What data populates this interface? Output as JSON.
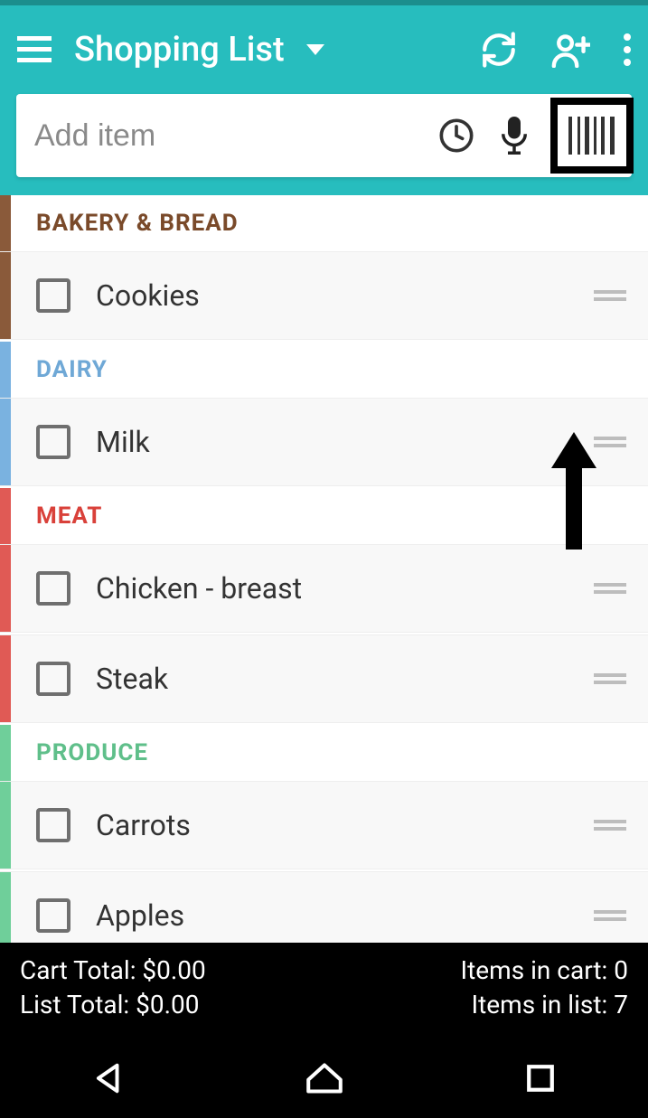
{
  "header": {
    "title": "Shopping List"
  },
  "search": {
    "placeholder": "Add item"
  },
  "categories": [
    {
      "name": "BAKERY & BREAD",
      "color": "#7a4a2a",
      "stripe": "#8a5a3a",
      "items": [
        "Cookies"
      ]
    },
    {
      "name": "DAIRY",
      "color": "#6fa8d6",
      "stripe": "#7ab2e0",
      "items": [
        "Milk"
      ]
    },
    {
      "name": "MEAT",
      "color": "#d9413a",
      "stripe": "#e05a55",
      "items": [
        "Chicken - breast",
        "Steak"
      ]
    },
    {
      "name": "PRODUCE",
      "color": "#5fbf8a",
      "stripe": "#6fcf9a",
      "items": [
        "Carrots",
        "Apples"
      ]
    }
  ],
  "footer": {
    "cart_total_label": "Cart Total: $0.00",
    "list_total_label": "List Total: $0.00",
    "items_cart_label": "Items in cart: 0",
    "items_list_label": "Items in list: 7"
  }
}
